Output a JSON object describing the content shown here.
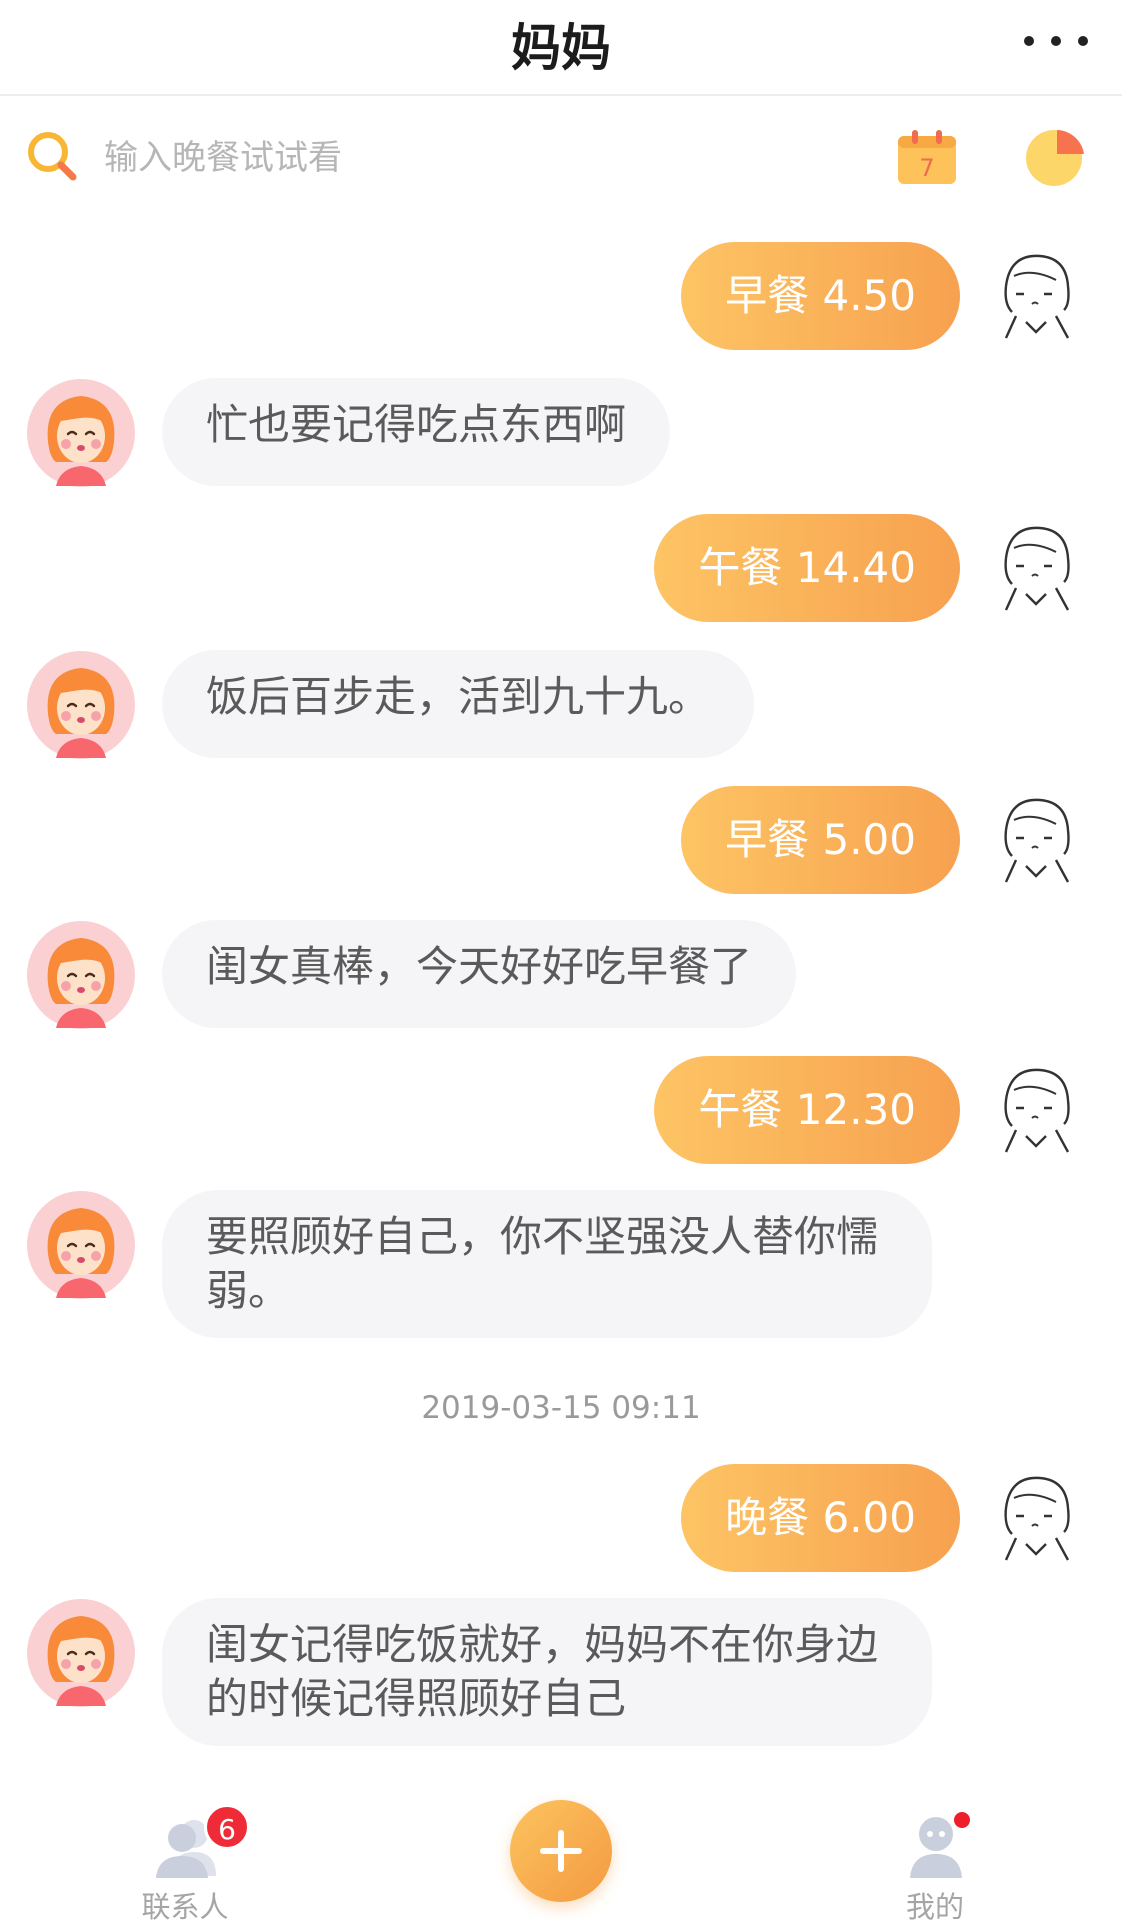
{
  "header": {
    "title": "妈妈"
  },
  "search": {
    "placeholder": "输入晚餐试试看",
    "calendar_day": "7"
  },
  "messages": [
    {
      "from": "me",
      "text": "早餐 4.50"
    },
    {
      "from": "mom",
      "text": "忙也要记得吃点东西啊"
    },
    {
      "from": "me",
      "text": "午餐 14.40"
    },
    {
      "from": "mom",
      "text": "饭后百步走，活到九十九。"
    },
    {
      "from": "me",
      "text": "早餐 5.00"
    },
    {
      "from": "mom",
      "text": "闺女真棒，今天好好吃早餐了"
    },
    {
      "from": "me",
      "text": "午餐 12.30"
    },
    {
      "from": "mom",
      "text": "要照顾好自己，你不坚强没人替你懦弱。"
    },
    {
      "from": "me",
      "text": "晚餐 6.00"
    },
    {
      "from": "mom",
      "text": "闺女记得吃饭就好，妈妈不在你身边的时候记得照顾好自己"
    }
  ],
  "timestamp": "2019-03-15 09:11",
  "tabbar": {
    "contacts_label": "联系人",
    "contacts_badge": "6",
    "mine_label": "我的"
  },
  "colors": {
    "accent_start": "#fdc464",
    "accent_end": "#f7a14f",
    "mom_bubble": "#f5f5f8",
    "badge": "#ee2b36"
  }
}
